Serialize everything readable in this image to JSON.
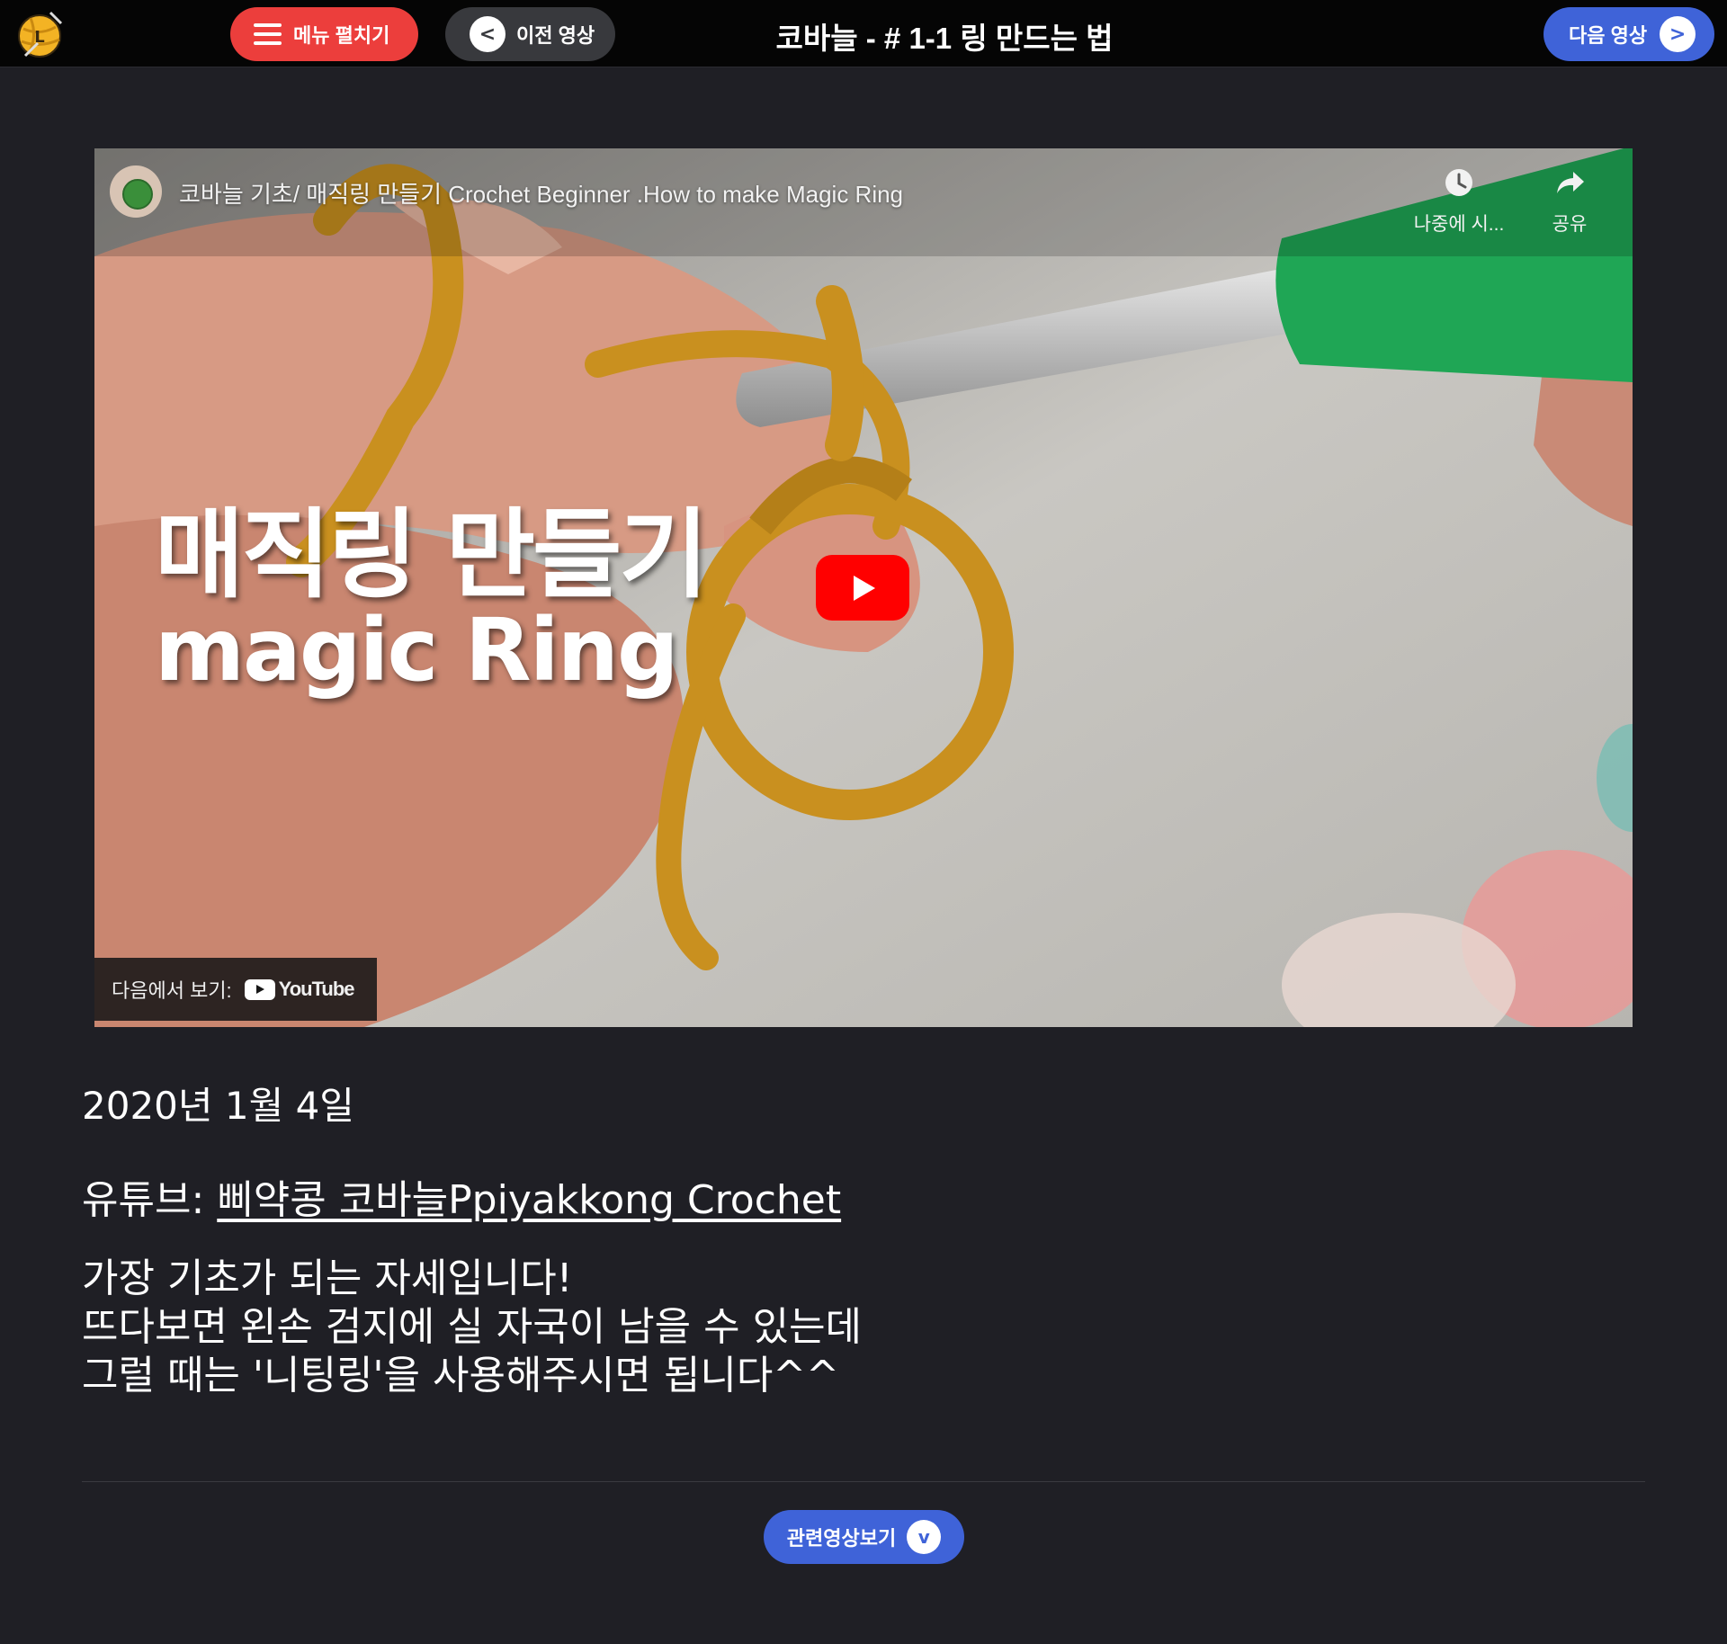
{
  "header": {
    "menu_label": "메뉴 펼치기",
    "prev_label": "이전 영상",
    "prev_icon": "<",
    "next_label": "다음 영상",
    "next_icon": ">",
    "title": "코바늘 - # 1-1 링 만드는 법"
  },
  "logo": {
    "letter": "L",
    "icon": "yarn-ball-logo-icon"
  },
  "video": {
    "title": "코바늘 기초/ 매직링 만들기 Crochet Beginner .How to make Magic Ring",
    "watch_later_label": "나중에 시...",
    "share_label": "공유",
    "overlay_line1": "매직링 만들기",
    "overlay_line2": "magic Ring",
    "watch_on_label": "다음에서 보기:",
    "youtube_brand": "YouTube"
  },
  "post": {
    "date": "2020년 1월 4일",
    "youtube_prefix": "유튜브: ",
    "youtube_channel": "삐약콩 코바늘Ppiyakkong Crochet",
    "description": [
      "가장 기초가 되는 자세입니다!",
      "뜨다보면 왼손 검지에 실 자국이 남을 수 있는데",
      "그럴 때는 '니팅링'을 사용해주시면 됩니다^^"
    ]
  },
  "related_button": {
    "label": "관련영상보기",
    "icon": "v"
  },
  "colors": {
    "background": "#1f1f25",
    "topbar": "#050505",
    "menu_button": "#ec3e3c",
    "prev_button": "#38393d",
    "accent_blue": "#3f63d8",
    "youtube_red": "#ff0000",
    "yarn_yellow": "#c9901f",
    "hook_green": "#1fa655"
  }
}
